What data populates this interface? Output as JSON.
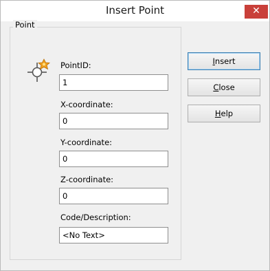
{
  "window": {
    "title": "Insert Point",
    "close_glyph": "✕"
  },
  "group": {
    "label": "Point",
    "icon": "point-marker-icon"
  },
  "fields": {
    "point_id": {
      "label": "PointID:",
      "value": "1"
    },
    "x": {
      "label": "X-coordinate:",
      "value": "0"
    },
    "y": {
      "label": "Y-coordinate:",
      "value": "0"
    },
    "z": {
      "label": "Z-coordinate:",
      "value": "0"
    },
    "code": {
      "label": "Code/Description:",
      "value": "<No Text>"
    }
  },
  "buttons": {
    "insert": {
      "mnemonic": "I",
      "rest": "nsert"
    },
    "close": {
      "mnemonic": "C",
      "rest": "lose"
    },
    "help": {
      "mnemonic": "H",
      "rest": "elp"
    }
  },
  "colors": {
    "close_button": "#c9403a",
    "dialog_bg": "#f0f0f0",
    "icon_accent": "#f0a020",
    "default_button_border": "#3c7fb1"
  }
}
